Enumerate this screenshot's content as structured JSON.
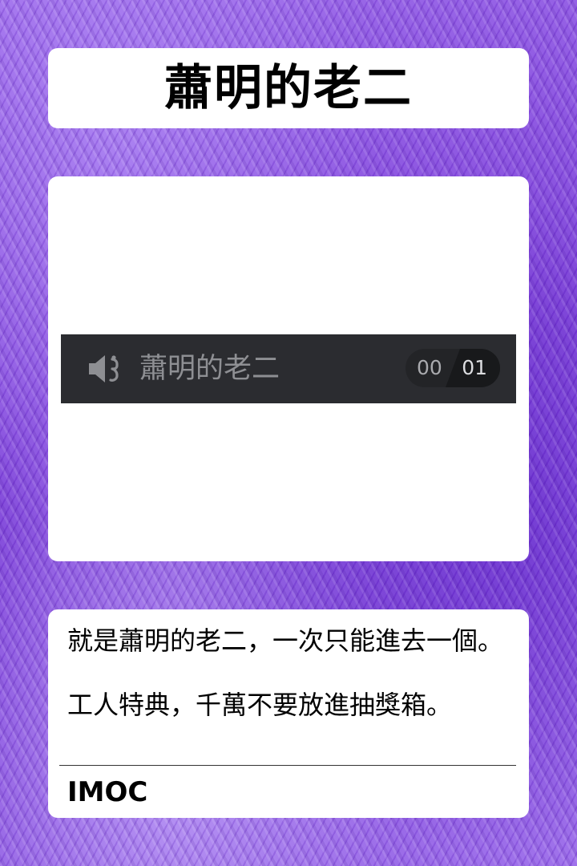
{
  "title": "蕭明的老二",
  "player": {
    "track_name": "蕭明的老二",
    "current_time": "00",
    "total_time": "01",
    "volume_icon": "speaker-volume-icon",
    "bar_color": "#2b2c30"
  },
  "description": {
    "line1": "就是蕭明的老二，一次只能進去一個。",
    "line2": "工人特典，千萬不要放進抽獎箱。"
  },
  "author": "IMOC",
  "colors": {
    "background": "#8a4fe0",
    "card": "#ffffff"
  }
}
